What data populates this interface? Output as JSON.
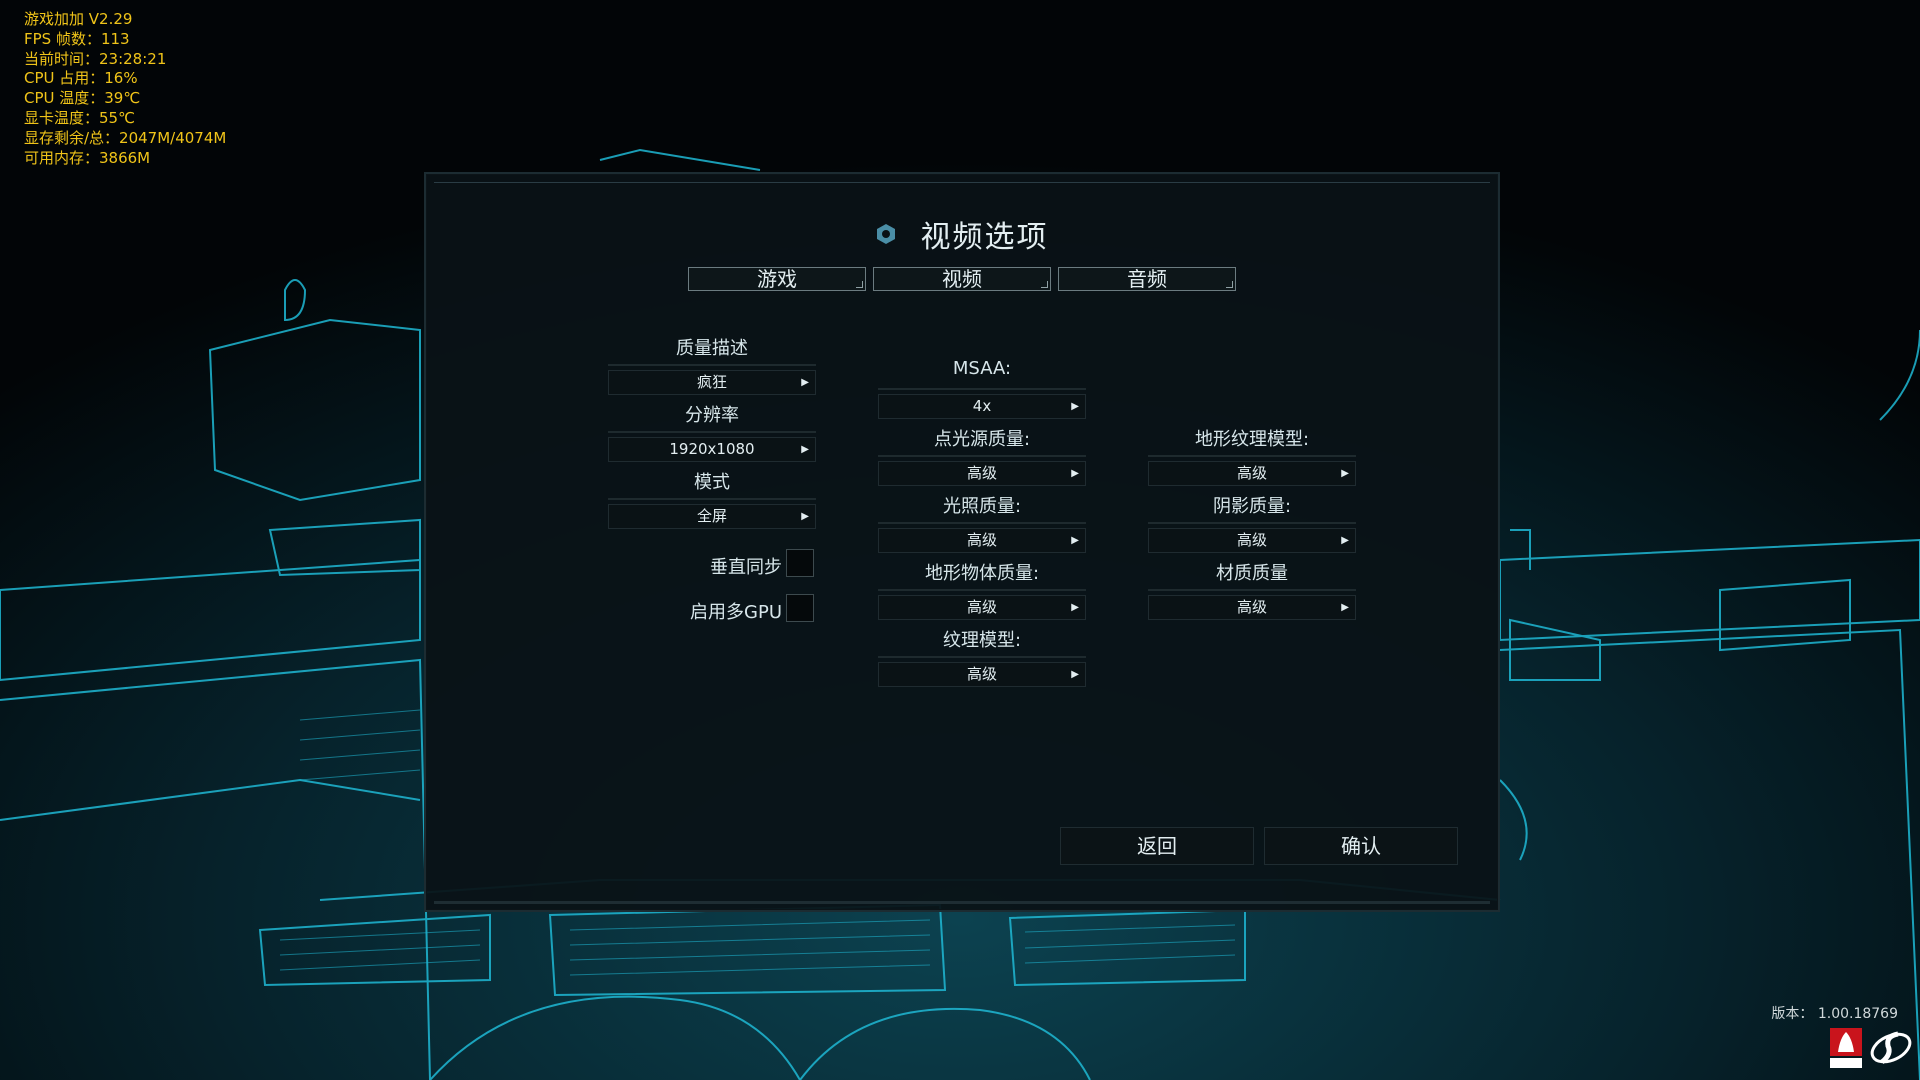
{
  "overlay": {
    "lines": [
      "游戏加加 V2.29",
      "FPS 帧数：113",
      "当前时间：23:28:21",
      "CPU 占用：16%",
      "CPU 温度：39℃",
      "显卡温度：55℃",
      "显存剩余/总：2047M/4074M",
      "可用内存：3866M"
    ]
  },
  "dialog": {
    "title": "视频选项",
    "tabs": [
      "游戏",
      "视频",
      "音频"
    ],
    "left": {
      "quality_label": "质量描述",
      "quality_value": "疯狂",
      "resolution_label": "分辨率",
      "resolution_value": "1920x1080",
      "mode_label": "模式",
      "mode_value": "全屏",
      "vsync_label": "垂直同步",
      "multigpu_label": "启用多GPU"
    },
    "middle": {
      "msaa_label": "MSAA:",
      "msaa_value": "4x",
      "pointlight_label": "点光源质量:",
      "pointlight_value": "高级",
      "lighting_label": "光照质量:",
      "lighting_value": "高级",
      "terrain_obj_label": "地形物体质量:",
      "terrain_obj_value": "高级",
      "texture_label": "纹理模型:",
      "texture_value": "高级"
    },
    "right": {
      "terrain_tex_label": "地形纹理模型:",
      "terrain_tex_value": "高级",
      "shadow_label": "阴影质量:",
      "shadow_value": "高级",
      "material_label": "材质质量",
      "material_value": "高级"
    },
    "buttons": {
      "back": "返回",
      "confirm": "确认"
    }
  },
  "footer": {
    "version": "版本：  1.00.18769"
  },
  "colors": {
    "overlay_text": "#f0c419",
    "accent_cyan": "#1fb8d4",
    "panel_bg": "#0a1216"
  }
}
